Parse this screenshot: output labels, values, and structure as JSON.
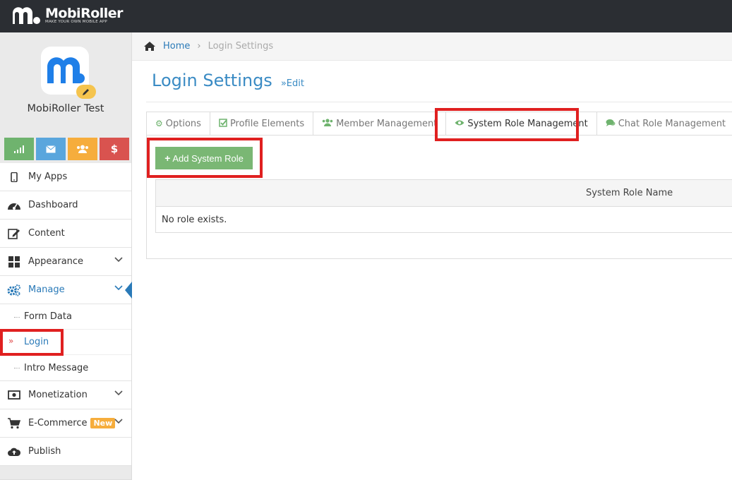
{
  "header": {
    "logo_name": "MobiRoller",
    "logo_tagline": "MAKE YOUR OWN MOBILE APP"
  },
  "sidebar": {
    "app_name": "MobiRoller Test",
    "quick_buttons": [
      {
        "icon": "signal-bars-icon",
        "color": "#6fb36e"
      },
      {
        "icon": "envelope-icon",
        "color": "#5aa6dd"
      },
      {
        "icon": "users-icon",
        "color": "#f6ad3c"
      },
      {
        "icon": "dollar-icon",
        "label": "$",
        "color": "#d9534f"
      }
    ],
    "items": [
      {
        "label": "My Apps",
        "icon": "mobile-icon"
      },
      {
        "label": "Dashboard",
        "icon": "dashboard-icon"
      },
      {
        "label": "Content",
        "icon": "edit-icon"
      },
      {
        "label": "Appearance",
        "icon": "grid-icon"
      },
      {
        "label": "Manage",
        "icon": "gears-icon"
      },
      {
        "label": "Monetization",
        "icon": "money-icon"
      },
      {
        "label": "E-Commerce",
        "icon": "cart-icon",
        "badge": "New"
      },
      {
        "label": "Publish",
        "icon": "cloud-upload-icon"
      }
    ],
    "manage_sub": [
      {
        "label": "Form Data"
      },
      {
        "label": "Login"
      },
      {
        "label": "Intro Message"
      }
    ]
  },
  "breadcrumb": {
    "home": "Home",
    "current": "Login Settings"
  },
  "page": {
    "title": "Login Settings",
    "subtitle": "»Edit"
  },
  "tabs": [
    {
      "label": "Options",
      "icon": "gear-icon"
    },
    {
      "label": "Profile Elements",
      "icon": "check-square-icon"
    },
    {
      "label": "Member Management",
      "icon": "users-icon"
    },
    {
      "label": "System Role Management",
      "icon": "eye-icon"
    },
    {
      "label": "Chat Role Management",
      "icon": "chat-icon"
    }
  ],
  "actions": {
    "add_label": "Add System Role"
  },
  "table": {
    "columns": [
      "System Role Name"
    ],
    "empty_message": "No role exists."
  },
  "colors": {
    "accent": "#2a7ab8",
    "success": "#7ab774",
    "highlight": "#e02020",
    "topbar": "#2b2e33"
  }
}
